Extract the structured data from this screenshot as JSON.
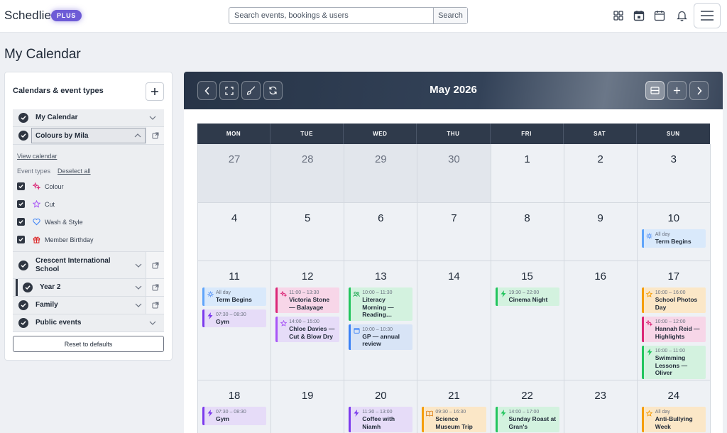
{
  "app": {
    "name": "Schedlie",
    "badge": "PLUS"
  },
  "search": {
    "placeholder": "Search events, bookings & users",
    "button": "Search"
  },
  "header_icons": [
    "grid-icon",
    "calendar-check-icon",
    "calendar-icon",
    "bell-icon",
    "menu-icon"
  ],
  "page": {
    "title": "My Calendar"
  },
  "sidebar": {
    "title": "Calendars & event types",
    "calendars": [
      {
        "label": "My Calendar"
      },
      {
        "label": "Colours by Mila",
        "expanded": true
      },
      {
        "label": "Crescent International School"
      },
      {
        "label": "Year 2"
      },
      {
        "label": "Family"
      },
      {
        "label": "Public events"
      }
    ],
    "view_calendar": "View calendar",
    "event_types_label": "Event types",
    "deselect_all": "Deselect all",
    "event_types": [
      {
        "label": "Colour",
        "color": "#db2777"
      },
      {
        "label": "Cut",
        "color": "#a855f7"
      },
      {
        "label": "Wash & Style",
        "color": "#3b82f6"
      },
      {
        "label": "Member Birthday",
        "color": "#dc2626"
      }
    ],
    "reset": "Reset to defaults"
  },
  "calendar": {
    "month": "May 2026",
    "weekdays": [
      "MON",
      "TUE",
      "WED",
      "THU",
      "FRI",
      "SAT",
      "SUN"
    ],
    "weeks": [
      [
        {
          "day": "27",
          "muted": true
        },
        {
          "day": "28",
          "muted": true
        },
        {
          "day": "29",
          "muted": true
        },
        {
          "day": "30",
          "muted": true
        },
        {
          "day": "1"
        },
        {
          "day": "2"
        },
        {
          "day": "3"
        }
      ],
      [
        {
          "day": "4"
        },
        {
          "day": "5"
        },
        {
          "day": "6"
        },
        {
          "day": "7"
        },
        {
          "day": "8"
        },
        {
          "day": "9"
        },
        {
          "day": "10",
          "events": [
            {
              "time": "All day",
              "name": "Term Begins",
              "color": "blue",
              "icon": "sun"
            }
          ]
        }
      ],
      [
        {
          "day": "11",
          "events": [
            {
              "time": "All day",
              "name": "Term Begins",
              "color": "blue",
              "icon": "sun"
            },
            {
              "time": "07:30 – 08:30",
              "name": "Gym",
              "color": "purple",
              "icon": "bolt"
            }
          ]
        },
        {
          "day": "12",
          "events": [
            {
              "time": "11:00 – 13:30",
              "name": "Victoria Stone — Balayage",
              "color": "magenta",
              "icon": "sparkle"
            },
            {
              "time": "14:00 – 15:00",
              "name": "Chloe Davies — Cut & Blow Dry",
              "color": "purple",
              "icon": "star"
            }
          ]
        },
        {
          "day": "13",
          "events": [
            {
              "time": "10:00 – 11:30",
              "name": "Literacy Morning — Reading…",
              "color": "green",
              "icon": "people"
            },
            {
              "time": "10:00 – 10:30",
              "name": "GP — annual review",
              "color": "navy",
              "icon": "cal"
            }
          ]
        },
        {
          "day": "14"
        },
        {
          "day": "15",
          "events": [
            {
              "time": "19:30 – 22:00",
              "name": "Cinema Night",
              "color": "green",
              "icon": "bolt"
            }
          ]
        },
        {
          "day": "16"
        },
        {
          "day": "17",
          "events": [
            {
              "time": "10:00 – 16:00",
              "name": "School Photos Day",
              "color": "orange",
              "icon": "star"
            },
            {
              "time": "10:00 – 12:00",
              "name": "Hannah Reid — Highlights",
              "color": "magenta",
              "icon": "sparkle"
            },
            {
              "time": "10:00 – 11:00",
              "name": "Swimming Lessons — Oliver",
              "color": "green",
              "icon": "bolt"
            }
          ]
        }
      ],
      [
        {
          "day": "18",
          "events": [
            {
              "time": "07:30 – 08:30",
              "name": "Gym",
              "color": "purple",
              "icon": "bolt"
            }
          ]
        },
        {
          "day": "19"
        },
        {
          "day": "20",
          "events": [
            {
              "time": "11:30 – 13:00",
              "name": "Coffee with Niamh",
              "color": "purple",
              "icon": "bolt"
            }
          ]
        },
        {
          "day": "21",
          "events": [
            {
              "time": "09:30 – 16:30",
              "name": "Science Museum Trip",
              "color": "orange",
              "icon": "book"
            }
          ],
          "more": true
        },
        {
          "day": "22",
          "events": [
            {
              "time": "14:00 – 17:00",
              "name": "Sunday Roast at Gran's",
              "color": "green",
              "icon": "bolt"
            }
          ]
        },
        {
          "day": "23"
        },
        {
          "day": "24",
          "events": [
            {
              "time": "All day",
              "name": "Anti-Bullying Week",
              "color": "orange",
              "icon": "star"
            }
          ]
        }
      ]
    ]
  }
}
